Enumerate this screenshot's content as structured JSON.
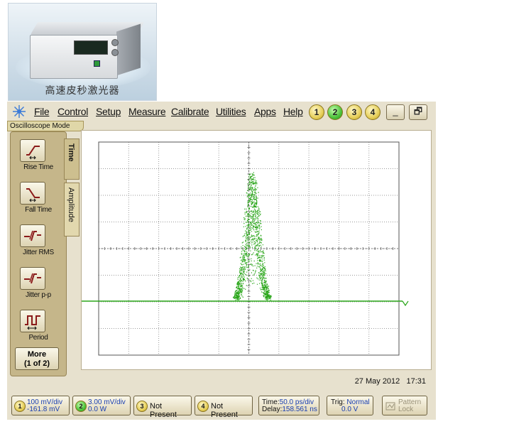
{
  "photo": {
    "caption": "高速皮秒激光器"
  },
  "menu": {
    "items": [
      {
        "id": "file",
        "label": "File"
      },
      {
        "id": "control",
        "label": "Control"
      },
      {
        "id": "setup",
        "label": "Setup"
      },
      {
        "id": "measure",
        "label": "Measure"
      },
      {
        "id": "calibrate",
        "label": "Calibrate"
      },
      {
        "id": "utilities",
        "label": "Utilities"
      },
      {
        "id": "apps",
        "label": "Apps"
      },
      {
        "id": "help",
        "label": "Help"
      }
    ],
    "channels": [
      "1",
      "2",
      "3",
      "4"
    ],
    "minimize_glyph": "_",
    "restore_glyph": "🗗"
  },
  "mode_label": "Oscilloscope Mode",
  "measurements": [
    {
      "label": "Rise Time",
      "icon": "rise-time-icon"
    },
    {
      "label": "Fall Time",
      "icon": "fall-time-icon"
    },
    {
      "label": "Jitter RMS",
      "icon": "jitter-rms-icon"
    },
    {
      "label": "Jitter p-p",
      "icon": "jitter-pp-icon"
    },
    {
      "label": "Period",
      "icon": "period-icon"
    }
  ],
  "more_button": {
    "line1": "More",
    "line2": "(1 of 2)"
  },
  "tabs": {
    "time": "Time",
    "amplitude": "Amplitude"
  },
  "status": {
    "date": "27 May 2012",
    "time": "17:31"
  },
  "bottom": {
    "ch1": {
      "num": "1",
      "line1": "100 mV/div",
      "line2": "-161.8 mV"
    },
    "ch2": {
      "num": "2",
      "line1": "3.00 mV/div",
      "line2": "0.0 W"
    },
    "ch3": {
      "num": "3",
      "text": "Not Present"
    },
    "ch4": {
      "num": "4",
      "text": "Not Present"
    },
    "timebase": {
      "label1": "Time:",
      "value1": "50.0 ps/div",
      "label2": "Delay:",
      "value2": "158.561 ns"
    },
    "trigger": {
      "label1": "Trig:",
      "value1": "Normal",
      "value2": "0.0 V"
    },
    "pattern_lock": {
      "line1": "Pattern",
      "line2": "Lock"
    }
  },
  "colors": {
    "trace": "#2aa61a",
    "accent_green": "#4cc23a",
    "channel_yellow": "#e6cf5a",
    "panel": "#e7e1ce"
  }
}
